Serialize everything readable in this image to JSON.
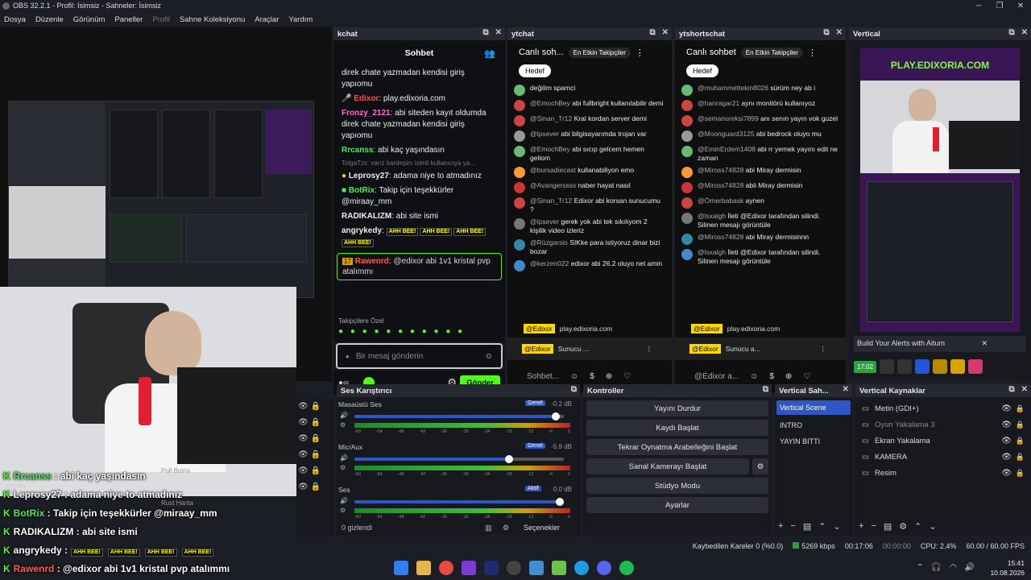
{
  "window": {
    "title": "OBS 32.2.1 - Profil: İsimsiz - Sahneler: İsimsiz"
  },
  "menu": [
    "Dosya",
    "Düzenle",
    "Görünüm",
    "Paneller",
    "Profil",
    "Sahne Koleksiyonu",
    "Araçlar",
    "Yardım"
  ],
  "kchat": {
    "title": "kchat",
    "tab": "Sohbet",
    "lines": [
      {
        "text": "direk chate yazmadan kendisi giriş yapıomu"
      },
      {
        "name": "Edixor",
        "text": "play.edixoria.com",
        "color": "#ff4b4b"
      },
      {
        "name": "Fronzy_2121",
        "text": "abi siteden kayıt oldumda direk chate yazmadan kendisi giriş yapıomu",
        "color": "#ff6fd1"
      },
      {
        "name": "Rrcanss",
        "text": "abi kaç yaşındasın",
        "color": "#58e36d"
      },
      {
        "reply": "TolgaTzs: varız kardeşim isimli kullanıcıya ya..."
      },
      {
        "name": "Leprosy27",
        "text": "adama niye to atmadınız",
        "color": "#ffffff"
      },
      {
        "name": "BotRix",
        "text": "Takip için teşekkürler @miraay_mm",
        "color": "#58e36d"
      },
      {
        "name": "RADIKALIZM",
        "text": "abi site ismi",
        "color": "#ffffff"
      },
      {
        "name": "angrykedy",
        "text": "",
        "color": "#ffffff"
      }
    ],
    "emote": "AHH BEE!",
    "pinned": {
      "badge": "17",
      "name": "Rawenrd",
      "text": "@edixor abi 1v1 kristal pvp atalımmı"
    },
    "follower_label": "Takipçilere Özel",
    "input_placeholder": "Bir mesaj gönderin",
    "send": "Gönder"
  },
  "ytchat": {
    "title": "ytchat",
    "header": "Canlı soh...",
    "top_fans": "En Etkin Takipçiler",
    "goal": "Hedef",
    "lines": [
      {
        "name": "",
        "text": "değilim spamci"
      },
      {
        "name": "@EmochBey",
        "text": "abi fullbright kullanılabilir demi"
      },
      {
        "name": "@Sinan_Tr12",
        "text": "Kral kordan server demi"
      },
      {
        "name": "@lpsever",
        "text": "abi bilgisayarımda trojan var"
      },
      {
        "name": "@EmochBey",
        "text": "abi sıcıp gelcem hemen geliom"
      },
      {
        "name": "@bursadiecast",
        "text": "kullanabiliyon emo"
      },
      {
        "name": "@Avangerssss",
        "text": "naber hayat nasıl"
      },
      {
        "name": "@Sinan_Tr12",
        "text": "Edixor abi korsan sunucumu ?"
      },
      {
        "name": "@lpsever",
        "text": "gerek yok abi tek sıkılıyom 2 kişilik video izleriz"
      },
      {
        "name": "@Rüzgarsio",
        "text": "SIKke para istiyoruz dinar bizi bozar"
      },
      {
        "name": "@kerzen022",
        "text": "edixor abi 26.2 oluyo net amin"
      }
    ],
    "owner_line": {
      "name": "@Edixor",
      "text": "play.edixoria.com"
    },
    "pinned": {
      "name": "@Edixor",
      "text": "Sunucu ..."
    },
    "input_placeholder": "Sohbet..."
  },
  "ytshortschat": {
    "title": "ytshortschat",
    "header": "Canlı sohbet",
    "top_fans": "En Etkin Takipçiler",
    "goal": "Hedef",
    "lines": [
      {
        "name": "@muhammettekin8026",
        "text": "sürüm ney ab i"
      },
      {
        "name": "@hanragar21",
        "text": "aynı monitörü kullanıyoz"
      },
      {
        "name": "@semanureksi7899",
        "text": "anı senın yayın vok guzel"
      },
      {
        "name": "@Moonguard3125",
        "text": "abi bedrock oluyo mu"
      },
      {
        "name": "@EminErdem1408",
        "text": "abi rr yemek yayını edit ne zaman"
      },
      {
        "name": "@Miross74828",
        "text": "abi Miray dermisin"
      },
      {
        "name": "@Miross74828",
        "text": "abii Miray dermisin"
      },
      {
        "name": "@Ömerbabask",
        "text": "aynen"
      },
      {
        "name": "@lsxalgh",
        "text": "İleti @Edixor tarafından silindi. Silinen mesajı görüntüle"
      },
      {
        "name": "@Miross74828",
        "text": "abi Miray dermisinnn"
      },
      {
        "name": "@lsxalgh",
        "text": "İleti @Edixor tarafından silindi. Silinen mesajı görüntüle"
      }
    ],
    "owner_line": {
      "name": "@Edixor",
      "text": "play.edixoria.com"
    },
    "pinned": {
      "name": "@Edixor",
      "text": "Sunucu a..."
    },
    "input_placeholder": "@Edixor a..."
  },
  "vertical": {
    "title": "Vertical",
    "banner": "PLAY.EDIXORIA.COM",
    "aitum": "Build Your Alerts with Aitum",
    "timer": "17:02"
  },
  "mixer": {
    "title": "Ses Karıştırıcı",
    "tracks": [
      {
        "name": "Masaüstü Ses",
        "tag": "Genel",
        "db": "-0.2 dB",
        "level": 0.96
      },
      {
        "name": "Mic/Aux",
        "tag": "Genel",
        "db": "-5.9 dB",
        "level": 0.74
      },
      {
        "name": "Ses",
        "tag": "Aktif",
        "db": "0.0 dB",
        "level": 0.98
      }
    ],
    "scale": [
      "-60",
      "-54",
      "-48",
      "-42",
      "-36",
      "-30",
      "-24",
      "-18",
      "-12",
      "-6",
      "0"
    ],
    "hidden": "0 gizlendi",
    "exts": "Seçenekler"
  },
  "controls": {
    "title": "Kontroller",
    "buttons": [
      "Yayını Durdur",
      "Kaydı Başlat",
      "Tekrar Oynatma Arabelleğini Başlat",
      "Sanal Kamerayı Başlat",
      "Stüdyo Modu",
      "Ayarlar"
    ]
  },
  "vscenes": {
    "title": "Vertical Sah...",
    "items": [
      "Vertical Scene",
      "INTRO",
      "YAYIN BITTI"
    ]
  },
  "vsources": {
    "title": "Vertical Kaynaklar",
    "items": [
      "Metin (GDI+)",
      "Oyun Yakalama 3",
      "Ekran Yakalama",
      "KAMERA",
      "Resim"
    ]
  },
  "sources_partial": [
    "chatttt",
    "Rust Harita",
    "Poll Botrix"
  ],
  "statusbar": {
    "dropped": "Kaybedilen Kareler 0 (%0.0)",
    "bitrate": "5269 kbps",
    "stream_time": "00:17:06",
    "rec_time": "00:00:00",
    "cpu": "CPU: 2.4%",
    "fps": "60.00 / 60.00 FPS"
  },
  "overlay_chat": [
    {
      "name": "Rrcanss",
      "text": ": abi kaç yaşındasın",
      "color": "#58e36d"
    },
    {
      "name": "Leprosy27",
      "text": ": adama niye to atmadınız",
      "color": "#ffffff"
    },
    {
      "name": "BotRix",
      "text": ": Takip için teşekkürler @miraay_mm",
      "color": "#58e36d"
    },
    {
      "name": "RADIKALIZM",
      "text": ": abi site ismi",
      "color": "#ffffff"
    },
    {
      "name": "angrykedy",
      "text": ":",
      "color": "#ffffff"
    },
    {
      "name": "Rawenrd",
      "text": ": @edixor abi 1v1 kristal pvp atalımmı",
      "color": "#ff5a5a"
    }
  ],
  "overlay_small": "Kamera",
  "taskbar": {
    "time": "15:41",
    "date": "10.08.2026"
  },
  "colors": {
    "accent": "#2d56c7",
    "kick_green": "#53fc18",
    "bg": "#1c1e25"
  }
}
